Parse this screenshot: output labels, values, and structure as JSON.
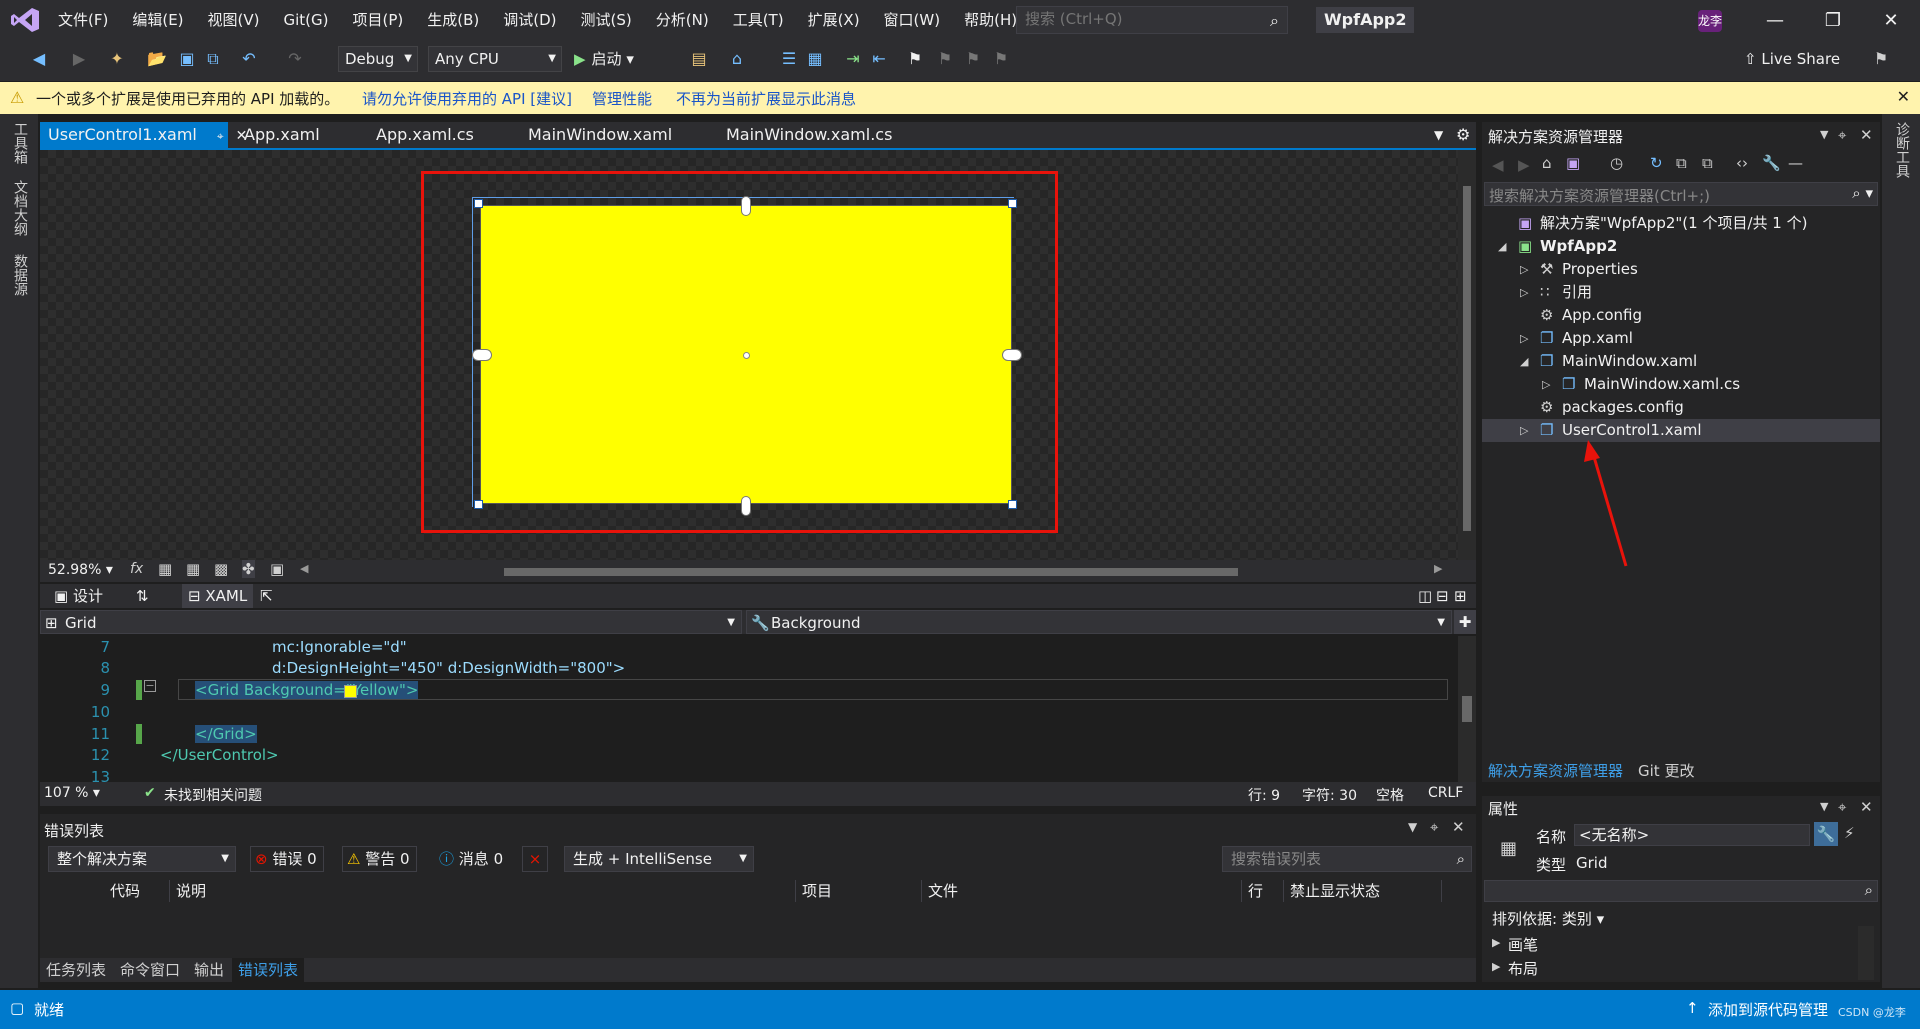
{
  "window": {
    "app_title": "WpfApp2",
    "user_initials": "龙李"
  },
  "menu": [
    "文件(F)",
    "编辑(E)",
    "视图(V)",
    "Git(G)",
    "项目(P)",
    "生成(B)",
    "调试(D)",
    "测试(S)",
    "分析(N)",
    "工具(T)",
    "扩展(X)",
    "窗口(W)",
    "帮助(H)"
  ],
  "search": {
    "placeholder": "搜索 (Ctrl+Q)"
  },
  "toolbar": {
    "config": "Debug",
    "platform": "Any CPU",
    "start": "启动",
    "live_share": "Live Share"
  },
  "infobar": {
    "message": "一个或多个扩展是使用已弃用的 API 加载的。",
    "links": [
      "请勿允许使用弃用的 API [建议]",
      "管理性能",
      "不再为当前扩展显示此消息"
    ]
  },
  "left_rail": [
    "工具箱",
    "文档大纲",
    "数据源"
  ],
  "right_rail": [
    "诊断工具"
  ],
  "doc_tabs": [
    "UserControl1.xaml",
    "App.xaml",
    "App.xaml.cs",
    "MainWindow.xaml",
    "MainWindow.xaml.cs"
  ],
  "designer": {
    "zoom": "52.98%",
    "grid_background": "#FFFF00"
  },
  "split_tabs": {
    "design": "设计",
    "xaml": "XAML"
  },
  "nav": {
    "left": "Grid",
    "right": "Background"
  },
  "code": {
    "line_numbers": [
      "7",
      "8",
      "9",
      "10",
      "11",
      "12",
      "13"
    ],
    "lines": [
      "mc:Ignorable=\"d\"",
      "d:DesignHeight=\"450\" d:DesignWidth=\"800\">",
      "<Grid Background=\"Yellow\">",
      "",
      "</Grid>",
      "</UserControl>",
      ""
    ]
  },
  "editor_status": {
    "zoom": "107 %",
    "issues": "未找到相关问题",
    "line": "行: 9",
    "char": "字符: 30",
    "spaces": "空格",
    "eol": "CRLF"
  },
  "error_list": {
    "title": "错误列表",
    "scope": "整个解决方案",
    "errors": "错误 0",
    "warnings": "警告 0",
    "messages": "消息 0",
    "build_filter": "生成 + IntelliSense",
    "search_placeholder": "搜索错误列表",
    "columns": [
      "代码",
      "说明",
      "项目",
      "文件",
      "行",
      "禁止显示状态"
    ]
  },
  "bottom_tabs": [
    "任务列表",
    "命令窗口",
    "输出",
    "错误列表"
  ],
  "solution_explorer": {
    "title": "解决方案资源管理器",
    "search_placeholder": "搜索解决方案资源管理器(Ctrl+;)",
    "items": [
      {
        "label": "解决方案\"WpfApp2\"(1 个项目/共 1 个)",
        "level": 0,
        "arrow": "",
        "icon": "solution-icon"
      },
      {
        "label": "WpfApp2",
        "level": 0,
        "arrow": "expanded",
        "icon": "csharp-project-icon"
      },
      {
        "label": "Properties",
        "level": 1,
        "arrow": "collapsed",
        "icon": "wrench-icon"
      },
      {
        "label": "引用",
        "level": 1,
        "arrow": "collapsed",
        "icon": "references-icon"
      },
      {
        "label": "App.config",
        "level": 1,
        "arrow": "",
        "icon": "config-file-icon"
      },
      {
        "label": "App.xaml",
        "level": 1,
        "arrow": "collapsed",
        "icon": "xaml-file-icon"
      },
      {
        "label": "MainWindow.xaml",
        "level": 1,
        "arrow": "expanded",
        "icon": "xaml-file-icon"
      },
      {
        "label": "MainWindow.xaml.cs",
        "level": 2,
        "arrow": "collapsed",
        "icon": "cs-file-icon"
      },
      {
        "label": "packages.config",
        "level": 1,
        "arrow": "",
        "icon": "config-file-icon"
      },
      {
        "label": "UserControl1.xaml",
        "level": 1,
        "arrow": "collapsed",
        "icon": "xaml-file-icon",
        "selected": true
      }
    ],
    "tabs": [
      "解决方案资源管理器",
      "Git 更改"
    ]
  },
  "properties": {
    "title": "属性",
    "name_label": "名称",
    "name_value": "<无名称>",
    "type_label": "类型",
    "type_value": "Grid",
    "sort_by": "排列依据: 类别",
    "categories": [
      "画笔",
      "布局"
    ]
  },
  "statusbar": {
    "ready": "就绪",
    "source_control": "添加到源代码管理",
    "watermark": "CSDN @龙李"
  },
  "colors": {
    "accent": "#007ACC",
    "highlight_red": "#E8130B",
    "yellow": "#FFFF00"
  }
}
